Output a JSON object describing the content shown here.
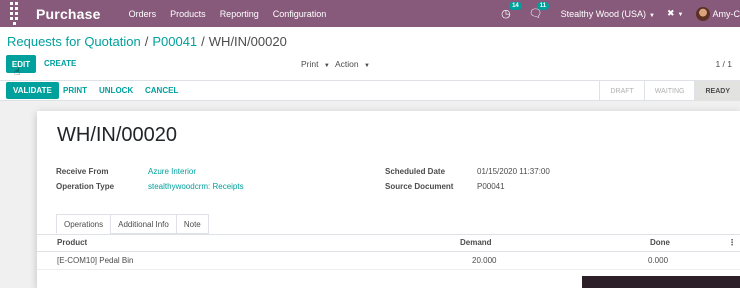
{
  "navbar": {
    "app_title": "Purchase",
    "menu": [
      "Orders",
      "Products",
      "Reporting",
      "Configuration"
    ],
    "activity_count": "14",
    "messages_count": "11",
    "company": "Stealthy Wood (USA)",
    "user": "Amy-C"
  },
  "breadcrumb": {
    "first": "Requests for Quotation",
    "second": "P00041",
    "current": "WH/IN/00020",
    "separator": "/"
  },
  "toolbar": {
    "edit_label": "EDIT",
    "create_label": "CREATE",
    "print_label": "Print",
    "action_label": "Action",
    "pager": "1 / 1"
  },
  "statusbar": {
    "validate_label": "VALIDATE",
    "print_label": "PRINT",
    "unlock_label": "UNLOCK",
    "cancel_label": "CANCEL",
    "stages": [
      {
        "label": "DRAFT",
        "active": false
      },
      {
        "label": "WAITING",
        "active": false
      },
      {
        "label": "READY",
        "active": true
      }
    ]
  },
  "record": {
    "title": "WH/IN/00020",
    "receive_from_label": "Receive From",
    "receive_from": "Azure Interior",
    "operation_type_label": "Operation Type",
    "operation_type": "stealthywoodcrm: Receipts",
    "scheduled_date_label": "Scheduled Date",
    "scheduled_date": "01/15/2020 11:37:00",
    "source_document_label": "Source Document",
    "source_document": "P00041"
  },
  "tabs": [
    "Operations",
    "Additional Info",
    "Note"
  ],
  "operations_table": {
    "columns": [
      "Product",
      "Demand",
      "Done"
    ],
    "rows": [
      {
        "product": "[E-COM10] Pedal Bin",
        "demand": "20.000",
        "done": "0.000"
      }
    ]
  },
  "colors": {
    "navbar": "#875a7b",
    "accent": "#00a09d"
  }
}
